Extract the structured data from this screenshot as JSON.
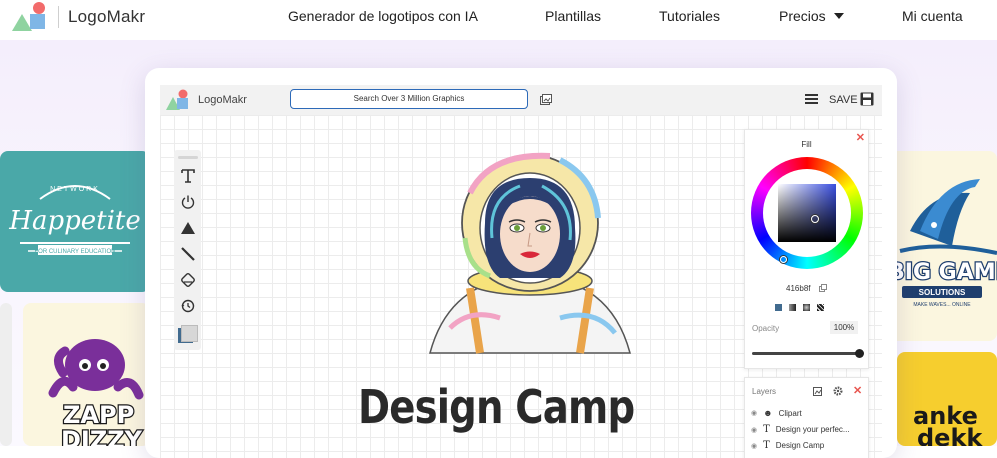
{
  "brand": {
    "name": "LogoMakr"
  },
  "nav": {
    "items": [
      {
        "label": "Generador de logotipos con IA"
      },
      {
        "label": "Plantillas"
      },
      {
        "label": "Tutoriales"
      },
      {
        "label": "Precios"
      },
      {
        "label": "Mi cuenta"
      }
    ]
  },
  "editor": {
    "brand": "LogoMakr",
    "search_placeholder": "Search Over 3 Million Graphics",
    "save_label": "SAVE",
    "canvas_text": "Design Camp",
    "fill": {
      "title": "Fill",
      "hex": "416b8f",
      "opacity_label": "Opacity",
      "opacity_value": "100%",
      "opacity_level": 1.0
    },
    "layers": {
      "title": "Layers",
      "items": [
        {
          "label": "Clipart"
        },
        {
          "label": "Design your perfec..."
        },
        {
          "label": "Design Camp"
        }
      ]
    }
  },
  "gallery": {
    "happetite": {
      "top": "NETWORK",
      "main": "Happetite",
      "sub": "FOR CULINARY EDUCATION"
    },
    "zappdizzy": {
      "line1": "ZAPP",
      "line2": "DIZZY"
    },
    "biggame": {
      "main": "BIG GAME",
      "sub": "SOLUTIONS",
      "tag": "MAKE WAVES... ONLINE"
    },
    "ankedekk": {
      "line1": "anke",
      "line2": "dekk"
    }
  },
  "colors": {
    "accent_blue": "#2d6ab8",
    "teal_tile": "#4aa8a8",
    "yellow_tile": "#f6ce2e",
    "cream_tile": "#fbf6df",
    "fill_color": "#416b8f"
  }
}
